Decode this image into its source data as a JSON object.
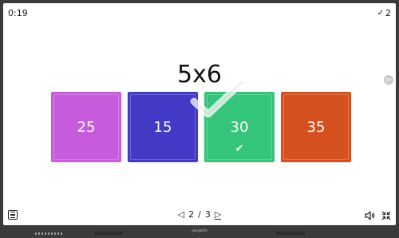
{
  "timer": "0:19",
  "score": {
    "icon": "check-icon",
    "value": "2"
  },
  "question": "5x6",
  "answers": [
    {
      "label": "25",
      "color": "#c65bdc",
      "correct": false
    },
    {
      "label": "15",
      "color": "#4239c6",
      "correct": false
    },
    {
      "label": "30",
      "color": "#35c47c",
      "correct": true
    },
    {
      "label": "35",
      "color": "#d64f1e",
      "correct": false
    }
  ],
  "pager": {
    "current": "2",
    "separator": "/",
    "total": "3"
  },
  "brand": "easypitch"
}
